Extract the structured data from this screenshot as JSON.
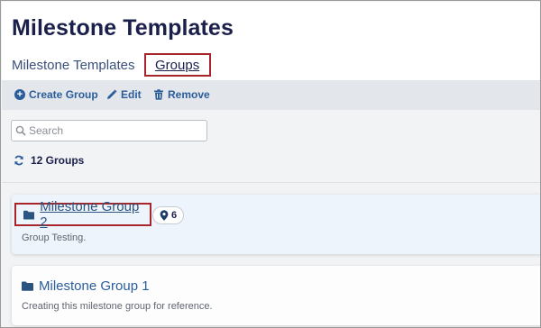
{
  "page": {
    "title": "Milestone Templates"
  },
  "tabs": [
    {
      "label": "Milestone Templates",
      "active": false
    },
    {
      "label": "Groups",
      "active": true
    }
  ],
  "toolbar": {
    "create_label": "Create Group",
    "edit_label": "Edit",
    "remove_label": "Remove"
  },
  "search": {
    "placeholder": "Search",
    "value": ""
  },
  "summary": {
    "count_label": "12 Groups"
  },
  "groups": [
    {
      "name": "Milestone Group 2",
      "description": "Group Testing.",
      "milestone_count": "6"
    },
    {
      "name": "Milestone Group 1",
      "description": "Creating this milestone group for reference."
    }
  ],
  "colors": {
    "accent": "#2b5d9b",
    "title": "#1b1f4b",
    "highlight_border": "#a8252b",
    "toolbar_bg": "#e3e6eb"
  }
}
